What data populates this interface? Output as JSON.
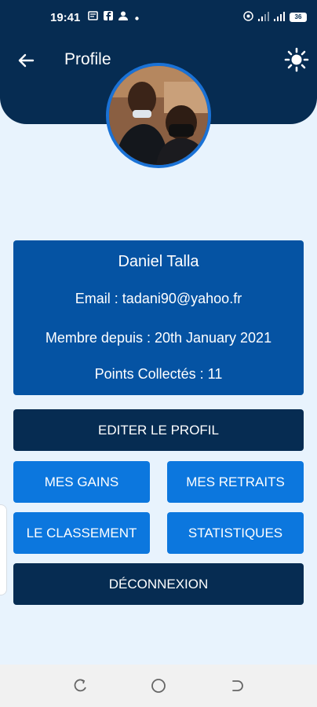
{
  "status_bar": {
    "time": "19:41",
    "battery": "36",
    "icons": [
      "message-icon",
      "facebook-icon",
      "person-icon",
      "dot-icon",
      "hotspot-icon",
      "signal-icon",
      "wifi-icon",
      "battery-icon"
    ]
  },
  "header": {
    "title": "Profile",
    "back_icon": "arrow-left-icon",
    "theme_icon": "sun-icon"
  },
  "profile": {
    "name": "Daniel Talla",
    "email": "Email : tadani90@yahoo.fr",
    "member_since": "Membre depuis : 20th January 2021",
    "points": "Points Collectés : 11"
  },
  "actions": {
    "edit": "EDITER LE PROFIL",
    "gains": "MES GAINS",
    "withdrawals": "MES RETRAITS",
    "ranking": "LE CLASSEMENT",
    "stats": "STATISTIQUES",
    "logout": "DÉCONNEXION"
  },
  "colors": {
    "header": "#062c52",
    "card": "#0553a3",
    "button_blue": "#0c77de",
    "background": "#e8f3fd"
  }
}
